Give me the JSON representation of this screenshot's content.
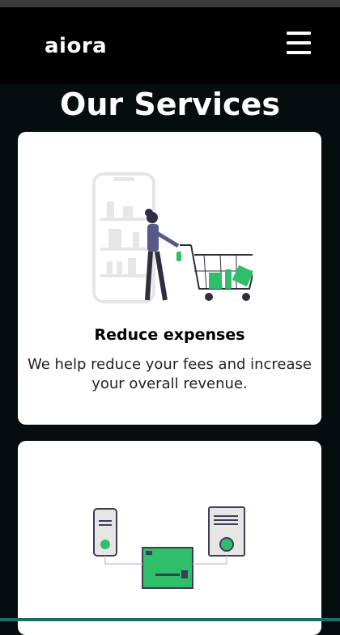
{
  "header": {
    "brand": "aiora",
    "menu_icon": "hamburger-menu-icon"
  },
  "section": {
    "title": "Our Services"
  },
  "services": [
    {
      "title": "Reduce expenses",
      "description": "We help reduce your fees and increase your overall revenue.",
      "illustration": "shopping-cart-illustration"
    },
    {
      "title": "",
      "description": "",
      "illustration": "payment-terminals-illustration"
    }
  ],
  "colors": {
    "accent": "#2fbf6a",
    "header_bg": "#000000",
    "page_bg": "#050d0e",
    "card_bg": "#ffffff"
  }
}
